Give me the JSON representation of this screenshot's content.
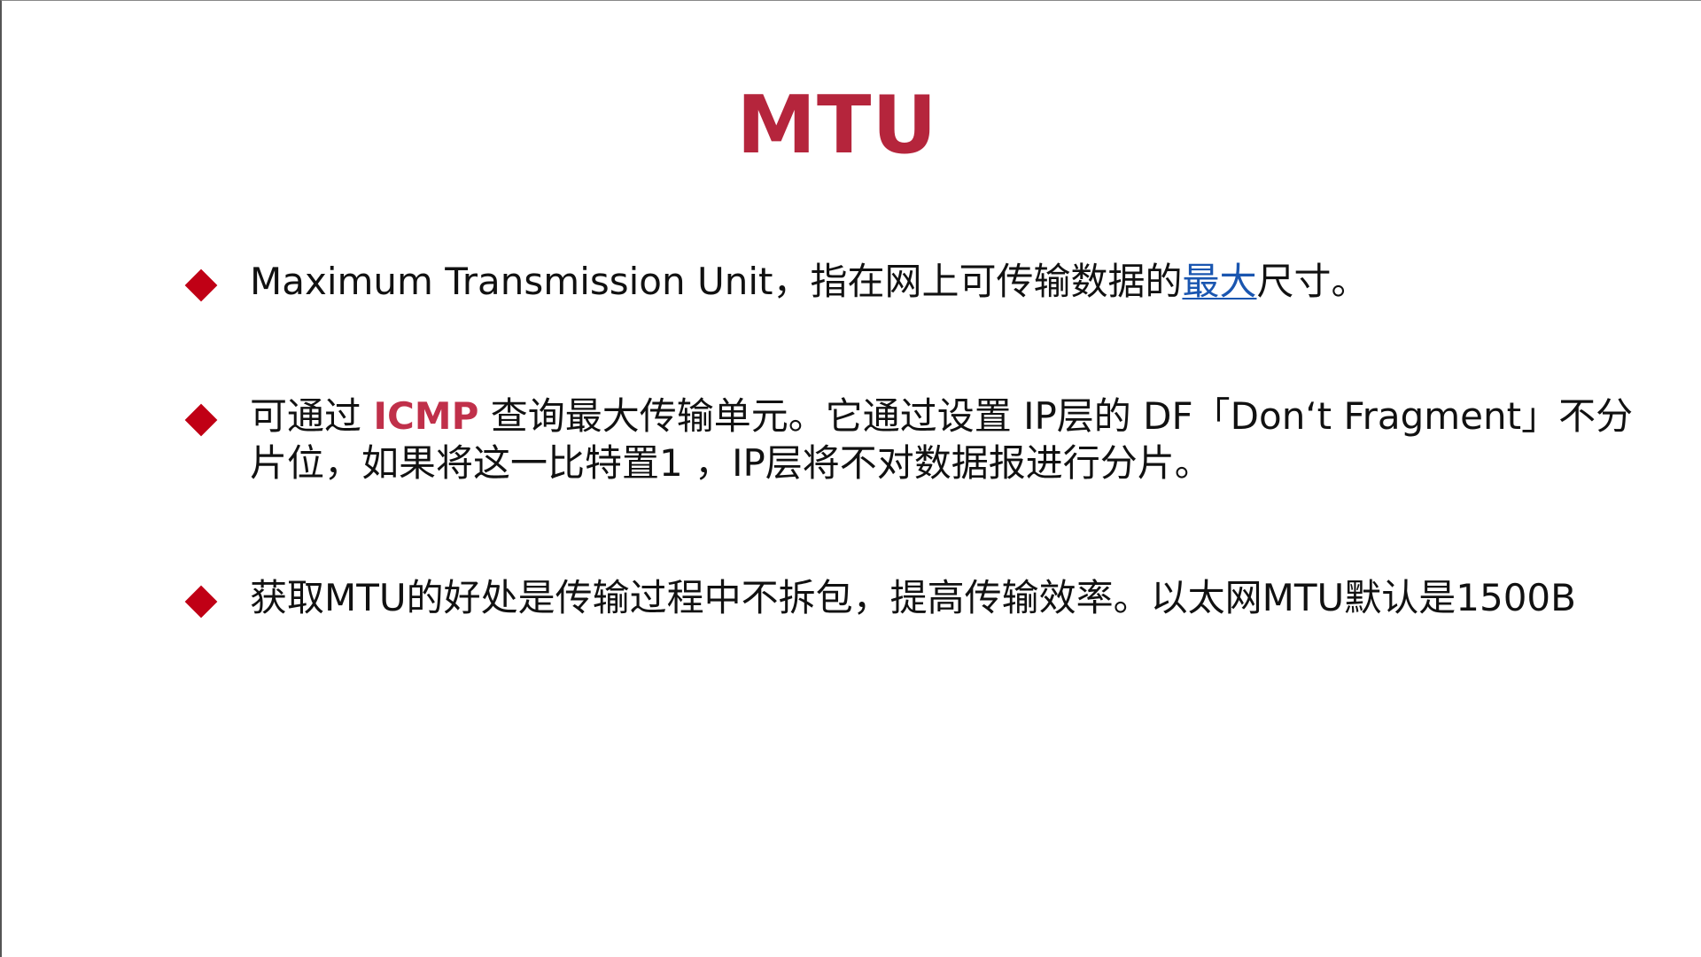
{
  "slide": {
    "title": "MTU",
    "bullet1": {
      "before_link": "Maximum Transmission Unit，指在网上可传输数据的",
      "link": "最大",
      "after_link": "尺寸。"
    },
    "bullet2": {
      "before_highlight": "可通过 ",
      "highlight": "ICMP",
      "after_highlight": " 查询最大传输单元。它通过设置 IP层的 DF「Don‘t Fragment」不分片位，如果将这一比特置1 ，IP层将不对数据报进行分片。"
    },
    "bullet3": {
      "text": "获取MTU的好处是传输过程中不拆包，提高传输效率。以太网MTU默认是1500B"
    },
    "colors": {
      "title": "#b5253c",
      "bullet_marker": "#c00015",
      "link": "#1a56b0",
      "highlight": "#c0304a"
    },
    "icons": {
      "bullet_marker": "diamond-icon"
    }
  }
}
